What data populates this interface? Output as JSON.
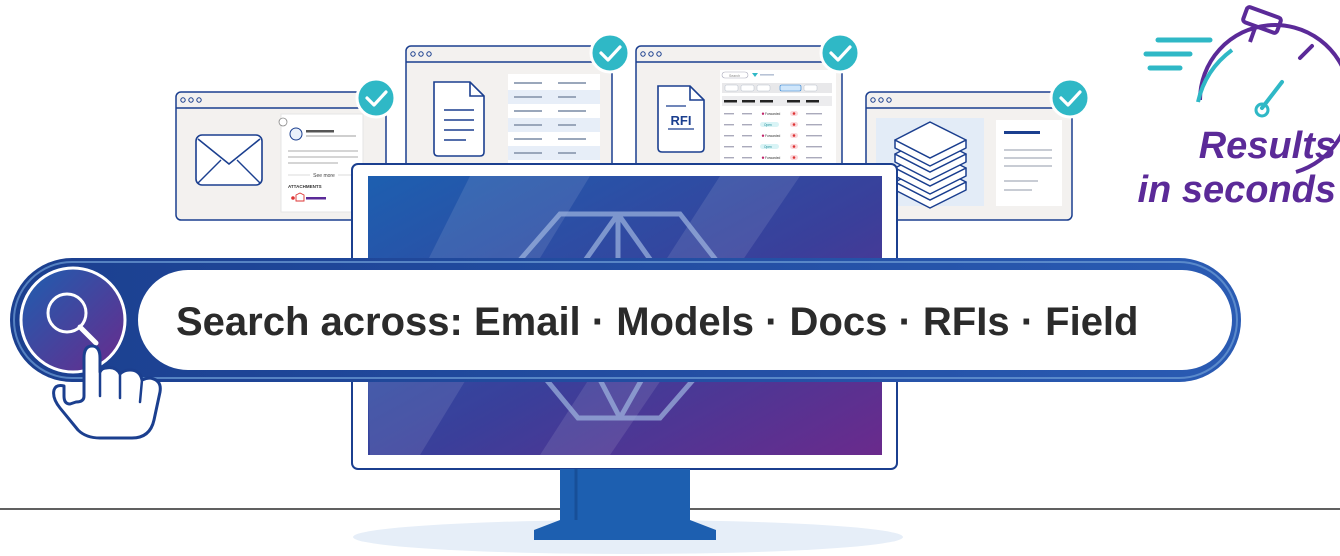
{
  "search_bar": {
    "label": "Search across: Email · Models · Docs · RFIs · Field",
    "icon": "search-icon",
    "pointer_icon": "hand-pointer-icon"
  },
  "tagline": {
    "line1": "Results",
    "line2": "in seconds",
    "icon": "stopwatch-icon"
  },
  "email_window": {
    "see_more": "See more",
    "attachments": "ATTACHMENTS"
  },
  "rfi_doc": {
    "label": "RFI"
  },
  "rfi_table": {
    "search_placeholder": "Search",
    "statuses": [
      "Forwarded",
      "Open",
      "Forwarded",
      "Open",
      "Forwarded",
      "Open"
    ]
  },
  "colors": {
    "navy": "#1b3f8f",
    "check_teal": "#2fb8c6",
    "purple": "#5b2a98",
    "screen_blue": "#1d5fb0",
    "screen_purple": "#6a2a8c",
    "window_bg": "#f3f1ef"
  }
}
